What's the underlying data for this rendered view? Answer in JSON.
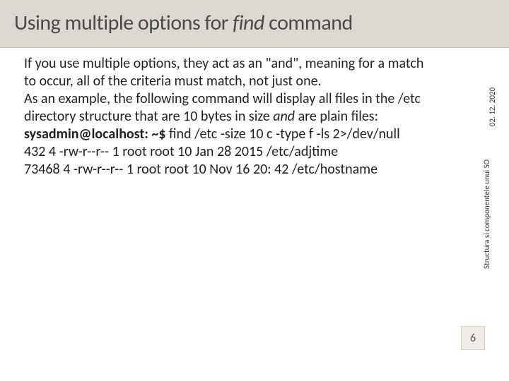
{
  "header": {
    "title_pre": "Using multiple options for ",
    "title_em": "find",
    "title_post": " command"
  },
  "content": {
    "p1a": "If you use multiple options, they act as an \"and\", meaning for a match to occur, all of the criteria must match, not just one.",
    "p2a": "As an example, the following command will display all files in the /etc directory structure that are 10 bytes in size ",
    "p2em": "and",
    "p2b": " are plain files:",
    "prompt": "sysadmin@localhost: ~$",
    "cmd": " find /etc -size 10 c -type f -ls 2>/dev/null",
    "out1": "432 4 -rw-r--r-- 1 root root 10 Jan 28 2015 /etc/adjtime",
    "out2": "73468 4 -rw-r--r-- 1 root root 10 Nov 16 20: 42 /etc/hostname"
  },
  "side": {
    "date": "02. 12. 2020",
    "course": "Structura si componentele unui SO"
  },
  "page": {
    "num": "6"
  }
}
